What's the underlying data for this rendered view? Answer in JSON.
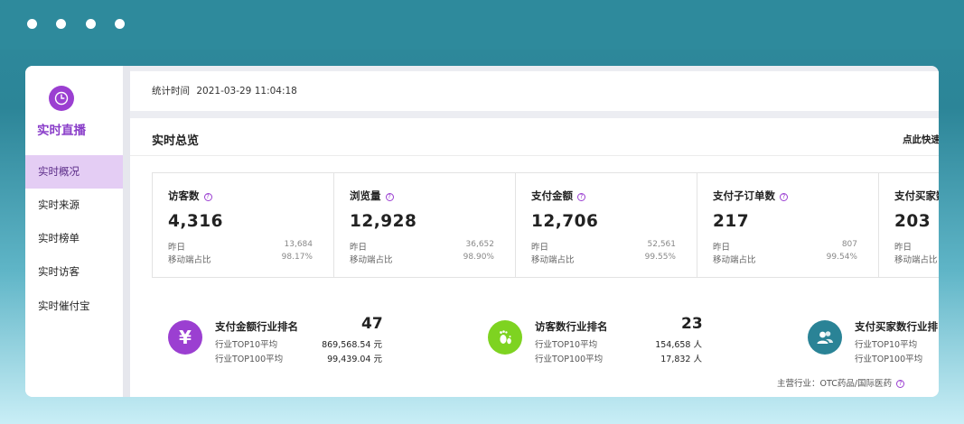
{
  "window_dots": 4,
  "sidebar": {
    "brand_title": "实时直播",
    "items": [
      {
        "label": "实时概况",
        "active": true
      },
      {
        "label": "实时来源",
        "active": false
      },
      {
        "label": "实时榜单",
        "active": false
      },
      {
        "label": "实时访客",
        "active": false
      },
      {
        "label": "实时催付宝",
        "active": false
      }
    ]
  },
  "stat_bar": {
    "label": "统计时间",
    "value": "2021-03-29 11:04:18"
  },
  "panel": {
    "title": "实时总览",
    "link": "点此快速"
  },
  "metrics": [
    {
      "label": "访客数",
      "value": "4,316",
      "yesterday_label": "昨日",
      "yesterday": "13,684",
      "mobile_label": "移动端占比",
      "mobile": "98.17%"
    },
    {
      "label": "浏览量",
      "value": "12,928",
      "yesterday_label": "昨日",
      "yesterday": "36,652",
      "mobile_label": "移动端占比",
      "mobile": "98.90%"
    },
    {
      "label": "支付金额",
      "value": "12,706",
      "yesterday_label": "昨日",
      "yesterday": "52,561",
      "mobile_label": "移动端占比",
      "mobile": "99.55%"
    },
    {
      "label": "支付子订单数",
      "value": "217",
      "yesterday_label": "昨日",
      "yesterday": "807",
      "mobile_label": "移动端占比",
      "mobile": "99.54%"
    },
    {
      "label": "支付买家数",
      "value": "203",
      "yesterday_label": "昨日",
      "yesterday": "",
      "mobile_label": "移动端占比",
      "mobile": ""
    }
  ],
  "rankings": [
    {
      "title": "支付金额行业排名",
      "value": "47",
      "icon": "yen-icon",
      "color": "#9b3fd1",
      "top10_label": "行业TOP10平均",
      "top10": "869,568.54 元",
      "top100_label": "行业TOP100平均",
      "top100": "99,439.04 元"
    },
    {
      "title": "访客数行业排名",
      "value": "23",
      "icon": "footprint-icon",
      "color": "#7ed321",
      "top10_label": "行业TOP10平均",
      "top10": "154,658 人",
      "top100_label": "行业TOP100平均",
      "top100": "17,832 人"
    },
    {
      "title": "支付买家数行业排",
      "value": "",
      "icon": "users-icon",
      "color": "#2a8396",
      "top10_label": "行业TOP10平均",
      "top10": "",
      "top100_label": "行业TOP100平均",
      "top100": ""
    }
  ],
  "industry": {
    "label": "主营行业：",
    "value": "OTC药品/国际医药"
  },
  "colors": {
    "accent": "#9b3fd1",
    "active_bg": "#e4cdf4",
    "titlebar": "#2e8a9c"
  }
}
